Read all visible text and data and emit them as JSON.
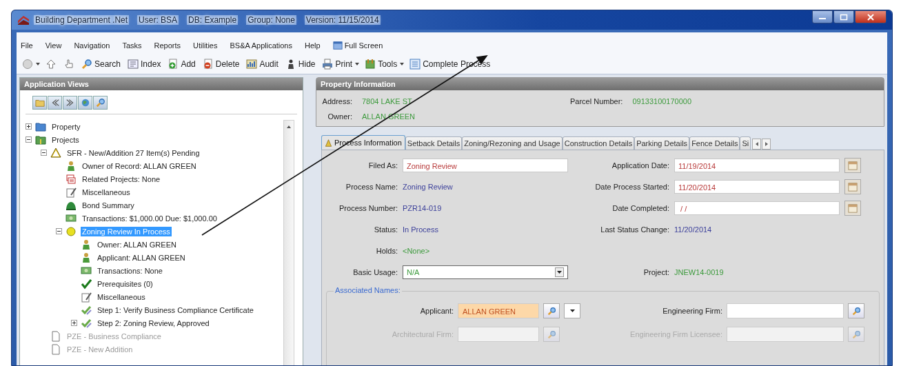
{
  "window": {
    "title_parts": [
      "Building Department .Net",
      "User: BSA",
      "DB: Example",
      "Group: None",
      "Version: 11/15/2014"
    ]
  },
  "menu": [
    {
      "label": "File"
    },
    {
      "label": "View"
    },
    {
      "label": "Navigation"
    },
    {
      "label": "Tasks"
    },
    {
      "label": "Reports"
    },
    {
      "label": "Utilities"
    },
    {
      "label": "BS&A Applications"
    },
    {
      "label": "Help"
    },
    {
      "label": "Full Screen",
      "kind": "window"
    }
  ],
  "toolbar": [
    {
      "kind": "back",
      "dropdown": true
    },
    {
      "kind": "up"
    },
    {
      "kind": "hand"
    },
    {
      "kind": "search",
      "label": "Search"
    },
    {
      "kind": "index",
      "label": "Index"
    },
    {
      "kind": "add",
      "label": "Add"
    },
    {
      "kind": "delete",
      "label": "Delete"
    },
    {
      "kind": "audit",
      "label": "Audit"
    },
    {
      "kind": "hide",
      "label": "Hide"
    },
    {
      "kind": "print",
      "label": "Print",
      "dropdown": true
    },
    {
      "kind": "tools",
      "label": "Tools",
      "dropdown": true
    },
    {
      "kind": "complete",
      "label": "Complete Process"
    }
  ],
  "sidebar": {
    "title": "Application Views",
    "tools": [
      {
        "kind": "open"
      },
      {
        "kind": "collapse"
      },
      {
        "kind": "expand"
      },
      {
        "kind": "globe"
      },
      {
        "kind": "find"
      }
    ],
    "tree": [
      {
        "label": "Property",
        "kind": "property",
        "expanded": false,
        "selected": false
      },
      {
        "label": "Projects",
        "kind": "projects",
        "expanded": true,
        "selected": false,
        "children": [
          {
            "label": "SFR - New/Addition 27 Item(s) Pending",
            "kind": "pending",
            "expanded": true,
            "selected": false,
            "children": [
              {
                "label": "Owner of Record: ALLAN GREEN",
                "kind": "person",
                "selected": false
              },
              {
                "label": "Related Projects: None",
                "kind": "related",
                "selected": false
              },
              {
                "label": "Miscellaneous",
                "kind": "misc",
                "selected": false
              },
              {
                "label": "Bond Summary",
                "kind": "bond",
                "selected": false
              },
              {
                "label": "Transactions: $1,000.00 Due: $1,000.00",
                "kind": "money",
                "selected": false
              },
              {
                "label": "Zoning Review In Process",
                "kind": "process",
                "expanded": true,
                "selected": true,
                "children": [
                  {
                    "label": "Owner: ALLAN GREEN",
                    "kind": "person",
                    "selected": false
                  },
                  {
                    "label": "Applicant: ALLAN GREEN",
                    "kind": "person",
                    "selected": false
                  },
                  {
                    "label": "Transactions: None",
                    "kind": "money",
                    "selected": false
                  },
                  {
                    "label": "Prerequisites (0)",
                    "kind": "check",
                    "selected": false
                  },
                  {
                    "label": "Miscellaneous",
                    "kind": "misc",
                    "selected": false
                  },
                  {
                    "label": "Step 1: Verify Business Compliance Certificate",
                    "kind": "step",
                    "selected": false
                  },
                  {
                    "label": "Step 2: Zoning Review, Approved",
                    "kind": "step",
                    "expanded": false,
                    "selected": false
                  }
                ]
              }
            ]
          },
          {
            "label": "PZE - Business Compliance",
            "kind": "document",
            "selected": false,
            "disabled": true
          },
          {
            "label": "PZE - New Addition",
            "kind": "document",
            "selected": false,
            "disabled": true
          }
        ]
      }
    ]
  },
  "property_info": {
    "title": "Property Information",
    "fields": [
      {
        "label": "Address:",
        "value": "7804 LAKE ST"
      },
      {
        "label": "Parcel Number:",
        "value": "09133100170000"
      },
      {
        "label": "Owner:",
        "value": "ALLAN GREEN"
      }
    ]
  },
  "tabs": [
    {
      "label": "Process Information",
      "selected": true
    },
    {
      "label": "Setback Details",
      "selected": false
    },
    {
      "label": "Zoning/Rezoning and Usage",
      "selected": false
    },
    {
      "label": "Construction Details",
      "selected": false
    },
    {
      "label": "Parking Details",
      "selected": false
    },
    {
      "label": "Fence Details",
      "selected": false
    },
    {
      "label": "Si",
      "selected": false
    }
  ],
  "form": {
    "rows": [
      {
        "left": {
          "label": "Filed As:",
          "kind": "input",
          "value": "Zoning Review",
          "color": "#b83a3a"
        },
        "right": {
          "label": "Application Date:",
          "kind": "date",
          "value": "11/19/2014",
          "color": "#b83a3a"
        }
      },
      {
        "left": {
          "label": "Process Name:",
          "kind": "text",
          "value": "Zoning Review",
          "color": "#3b3f9a"
        },
        "right": {
          "label": "Date Process Started:",
          "kind": "date",
          "value": "11/20/2014",
          "color": "#b83a3a"
        }
      },
      {
        "left": {
          "label": "Process Number:",
          "kind": "text",
          "value": "PZR14-019",
          "color": "#3b3f9a"
        },
        "right": {
          "label": "Date Completed:",
          "kind": "date",
          "value": " / /"
        }
      },
      {
        "left": {
          "label": "Status:",
          "kind": "text",
          "value": "In Process",
          "color": "#3b3f9a"
        },
        "right": {
          "label": "Last Status Change:",
          "kind": "text",
          "value": "11/20/2014",
          "color": "#3b3f9a"
        }
      },
      {
        "left": {
          "label": "Holds:",
          "kind": "text",
          "value": "<None>",
          "color": "#3c9a3c"
        }
      },
      {
        "left": {
          "label": "Basic Usage:",
          "kind": "select",
          "value": "N/A",
          "color": "#3c9a3c"
        },
        "right": {
          "label": "Project:",
          "kind": "text",
          "value": "JNEW14-0019",
          "color": "#3c9a3c"
        }
      }
    ],
    "associated_names": {
      "title": "Associated Names:",
      "rows": [
        {
          "left": {
            "label": "Applicant:",
            "value": "ALLAN GREEN",
            "highlighted": true,
            "dropdown": true,
            "disabled": false
          },
          "right": {
            "label": "Engineering Firm:",
            "highlighted": false,
            "disabled": false
          }
        },
        {
          "left": {
            "label": "Architectural Firm:",
            "highlighted": false,
            "disabled": true
          },
          "right": {
            "label": "Engineering Firm Licensee:",
            "highlighted": false,
            "disabled": true
          }
        }
      ]
    }
  }
}
